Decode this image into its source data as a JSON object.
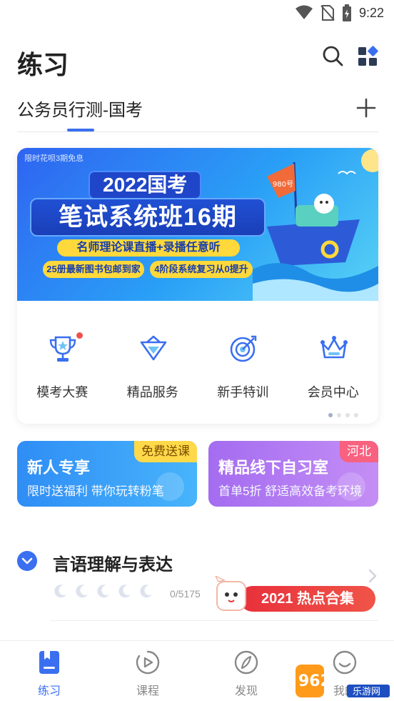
{
  "status_bar": {
    "time": "9:22"
  },
  "header": {
    "title": "练习"
  },
  "category": {
    "label": "公务员行测-国考"
  },
  "banner": {
    "note": "限时花呗3期免息",
    "year_title": "2022国考",
    "main_title": "笔试系统班16期",
    "pill_1": "名师理论课直播+录播任意听",
    "pill_2": "25册最新图书包邮到家",
    "pill_3": "4阶段系统复习从0提升",
    "ship_flag": "980号"
  },
  "services": [
    {
      "label": "模考大赛",
      "icon": "trophy-icon",
      "badge": true
    },
    {
      "label": "精品服务",
      "icon": "diamond-icon",
      "badge": false
    },
    {
      "label": "新手特训",
      "icon": "target-icon",
      "badge": false
    },
    {
      "label": "会员中心",
      "icon": "crown-icon",
      "badge": false
    }
  ],
  "promos": [
    {
      "title": "新人专享",
      "subtitle": "限时送福利 带你玩转粉笔",
      "badge": "免费送课"
    },
    {
      "title": "精品线下自习室",
      "subtitle": "首单5折 舒适高效备考环境",
      "badge": "河北"
    }
  ],
  "practice": {
    "section_title": "言语理解与表达",
    "progress": "0/5175",
    "hot_label": "2021 热点合集"
  },
  "bottom_nav": [
    {
      "label": "练习",
      "icon": "practice-icon",
      "active": true
    },
    {
      "label": "课程",
      "icon": "course-icon",
      "active": false
    },
    {
      "label": "发现",
      "icon": "discover-icon",
      "active": false
    },
    {
      "label": "我的",
      "icon": "profile-icon",
      "active": false
    }
  ],
  "watermark": {
    "text_1": "962.NET",
    "text_2": "乐游网"
  },
  "colors": {
    "accent": "#3a6ff0",
    "badge_red": "#f25050"
  }
}
